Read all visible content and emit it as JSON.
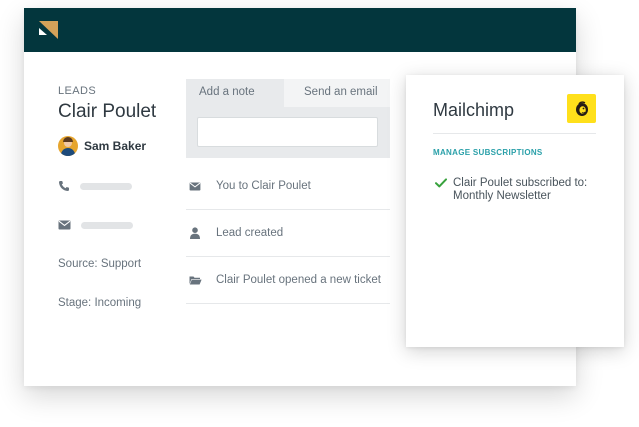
{
  "colors": {
    "header": "#03363d",
    "accent": "#2aa0a9",
    "check": "#38a23d",
    "mailchimp_yellow": "#ffe01b",
    "logo_gold": "#d4a259"
  },
  "icons": {
    "logo": "brand-logo-icon",
    "phone": "phone-icon",
    "email": "mail-icon",
    "user": "user-icon",
    "folder": "folder-icon",
    "mailchimp": "mailchimp-icon",
    "check": "check-icon"
  },
  "lead": {
    "section_label": "LEADS",
    "name": "Clair Poulet",
    "assignee": "Sam Baker",
    "source": "Source: Support",
    "stage": "Stage: Incoming"
  },
  "composer": {
    "tabs": [
      "Add a note",
      "Send an email"
    ],
    "active_tab": "Add a note",
    "note_value": ""
  },
  "activity": [
    {
      "icon": "mail-icon",
      "text": "You to Clair Poulet"
    },
    {
      "icon": "user-icon",
      "text": "Lead created"
    },
    {
      "icon": "folder-icon",
      "text": "Clair Poulet opened a new ticket"
    }
  ],
  "mailchimp": {
    "title": "Mailchimp",
    "manage_link": "MANAGE SUBSCRIPTIONS",
    "subscription_line1": "Clair Poulet subscribed to:",
    "subscription_line2": "Monthly Newsletter"
  }
}
